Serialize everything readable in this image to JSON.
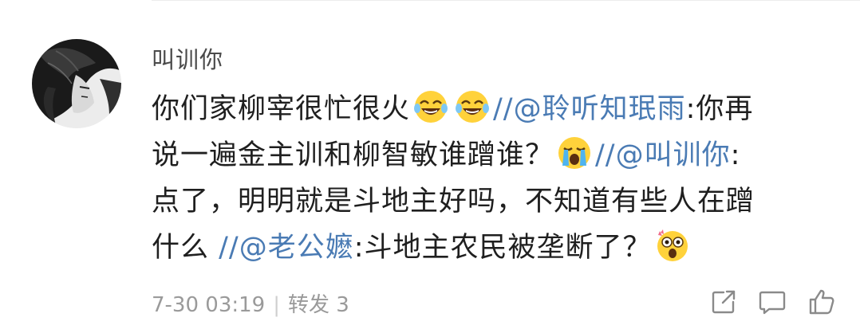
{
  "comment": {
    "username": "叫训你",
    "lines": [
      {
        "t1": "你们家柳宰很忙很火",
        "slashes": "//",
        "mention": "@聆听知珉雨",
        "t2": ":你再"
      },
      {
        "t1": "说一遍金主训和柳智敏谁蹭谁？",
        "slashes": "//",
        "mention": "@叫训你",
        "t2": ":"
      },
      {
        "t1": "点了，明明就是斗地主好吗，不知道有些人在蹭"
      },
      {
        "t1": "什么 ",
        "slashes": "//",
        "mention": "@老公嬷",
        "t2": ":斗地主农民被垄断了？"
      }
    ],
    "emojis": [
      "laugh-cry-emoji",
      "laugh-cry-emoji",
      "crying-emoji",
      "shocked-emoji"
    ],
    "meta": {
      "timestamp": "7-30 03:19",
      "separator": "|",
      "forward_label": "转发 3"
    },
    "actions": [
      "share-icon",
      "comment-icon",
      "like-icon"
    ]
  },
  "colors": {
    "mention": "#4a7bb4",
    "text": "#1f1f1f",
    "meta": "#9a9a9a"
  }
}
